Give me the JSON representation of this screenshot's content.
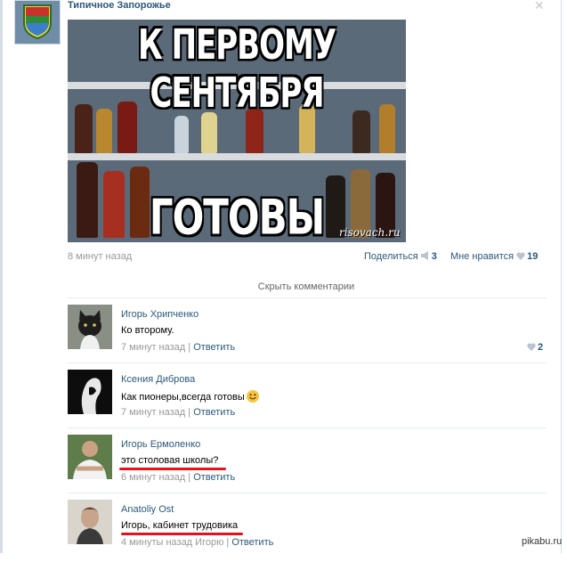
{
  "post": {
    "group_name": "Типичное Запорожье",
    "group_avatar_text": "Типичное Запорожье",
    "meme": {
      "top_text": "К ПЕРВОМУ СЕНТЯБРЯ",
      "bottom_text": "ГОТОВЫ",
      "watermark": "risovach.ru"
    },
    "time": "8 минут назад",
    "share_label": "Поделиться",
    "share_count": "3",
    "like_label": "Мне нравится",
    "like_count": "19",
    "hide_comments": "Скрыть комментарии"
  },
  "comments": [
    {
      "author": "Игорь Хрипченко",
      "text": "Ко второму.",
      "time": "7 минут назад",
      "sep": " | ",
      "reply": "Ответить",
      "likes": "2"
    },
    {
      "author": "Ксения Диброва",
      "text": "Как пионеры,всегда готовы",
      "time": "7 минут назад",
      "sep": " | ",
      "reply": "Ответить"
    },
    {
      "author": "Игорь Ермоленко",
      "text": "это столовая школы?",
      "time": "6 минут назад",
      "sep": " | ",
      "reply": "Ответить"
    },
    {
      "author": "Anatoliy Ost",
      "text": "Игорь, кабинет трудовика",
      "time": "4 минуты назад",
      "to": "Игорю",
      "sep": " | ",
      "reply": "Ответить"
    }
  ],
  "site_watermark": "pikabu.ru",
  "colors": {
    "link": "#2b587a",
    "meta": "#999999",
    "underline": "#e8101a"
  }
}
